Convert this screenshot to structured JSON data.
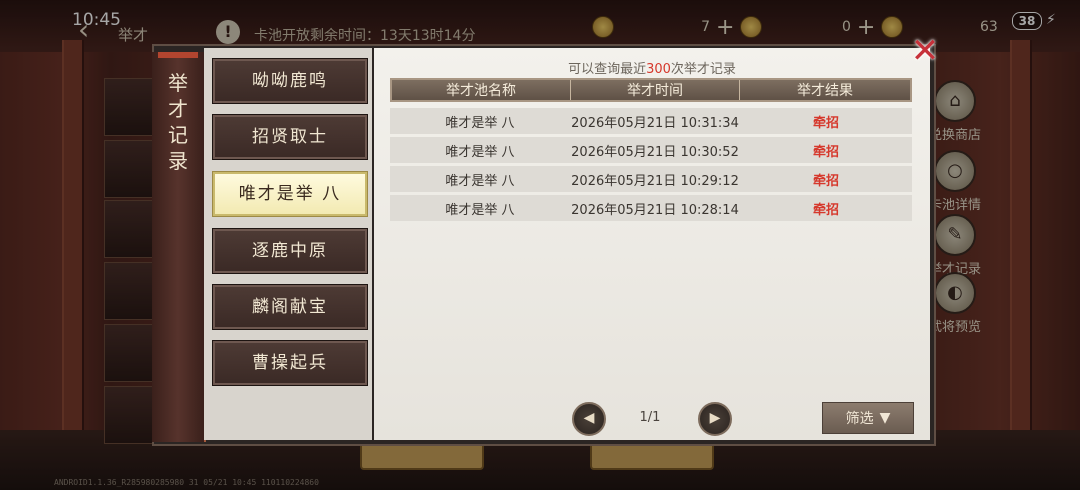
{
  "status_bar": {
    "time": "10:45",
    "battery": "38"
  },
  "header": {
    "back_label": "举才",
    "notice_text": "卡池开放剩余时间：13天13时14分",
    "resources": [
      {
        "value": "7"
      },
      {
        "value": "0"
      },
      {
        "value": "63"
      }
    ]
  },
  "side_buttons": [
    {
      "label": "兑换商店"
    },
    {
      "label": "卡池详情"
    },
    {
      "label": "举才记录"
    },
    {
      "label": "武将预览"
    }
  ],
  "modal": {
    "vertical_title": "举才记录",
    "menu": [
      {
        "label": "呦呦鹿鸣",
        "active": false
      },
      {
        "label": "招贤取士",
        "active": false
      },
      {
        "label": "唯才是举 八",
        "active": true
      },
      {
        "label": "逐鹿中原",
        "active": false
      },
      {
        "label": "麟阁献宝",
        "active": false
      },
      {
        "label": "曹操起兵",
        "active": false
      }
    ],
    "hint_prefix": "可以查询最近",
    "hint_number": "300",
    "hint_suffix": "次举才记录",
    "table": {
      "headers": [
        "举才池名称",
        "举才时间",
        "举才结果"
      ],
      "rows": [
        {
          "pool": "唯才是举 八",
          "time": "2026年05月21日 10:31:34",
          "result": "牵招"
        },
        {
          "pool": "唯才是举 八",
          "time": "2026年05月21日 10:30:52",
          "result": "牵招"
        },
        {
          "pool": "唯才是举 八",
          "time": "2026年05月21日 10:29:12",
          "result": "牵招"
        },
        {
          "pool": "唯才是举 八",
          "time": "2026年05月21日 10:28:14",
          "result": "牵招"
        }
      ]
    },
    "pager": {
      "page": "1/1"
    },
    "filter_label": "筛选"
  },
  "footer": {
    "build_info": "ANDROID1.1.36_R285980285980 31 05/21 10:45 110110224860"
  },
  "colors": {
    "accent_red": "#d6382c",
    "active_tab": "#f6efc4"
  }
}
